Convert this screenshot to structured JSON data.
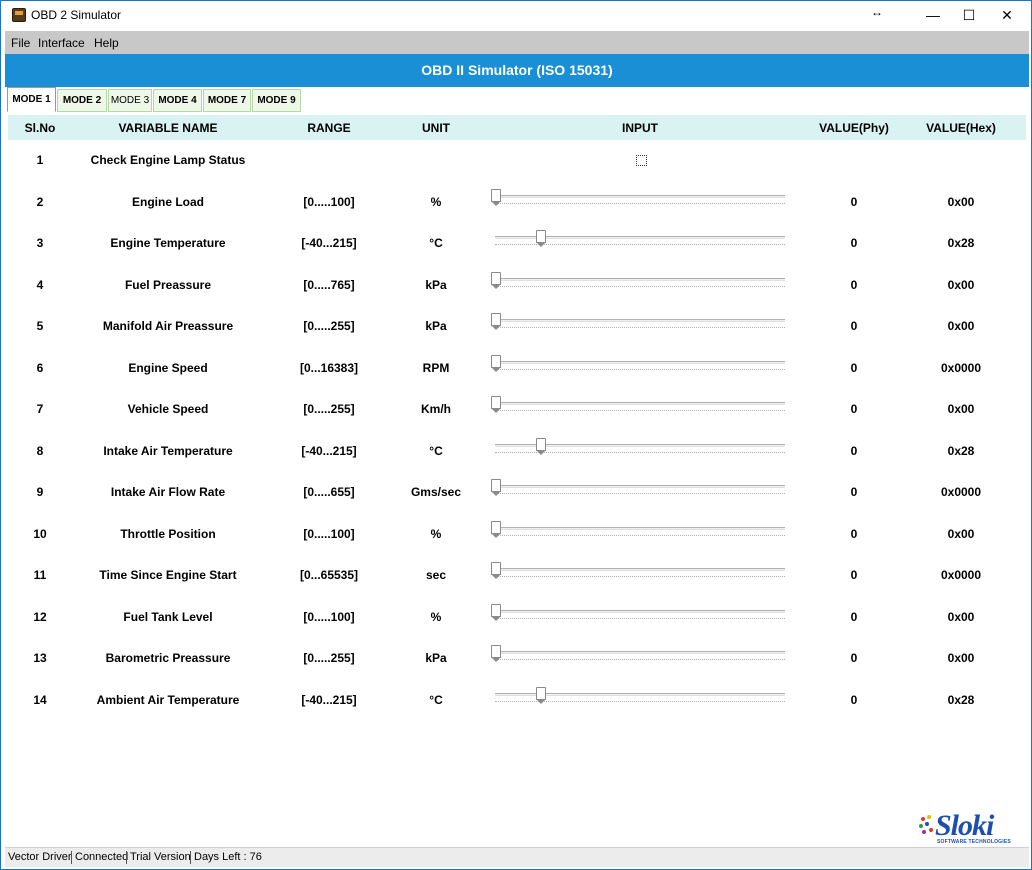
{
  "window": {
    "title": "OBD 2 Simulator",
    "resize_glyph": "↔",
    "minimize_glyph": "—",
    "maximize_glyph": "☐",
    "close_glyph": "✕"
  },
  "menu": [
    "File",
    "Interface",
    "Help"
  ],
  "header": {
    "title": "OBD II Simulator (ISO 15031)",
    "color": "#1a8fd6"
  },
  "tabs": [
    {
      "label": "MODE 1",
      "active": true
    },
    {
      "label": "MODE 2"
    },
    {
      "label": "MODE 3"
    },
    {
      "label": "MODE 4"
    },
    {
      "label": "MODE 7"
    },
    {
      "label": "MODE 9"
    }
  ],
  "columns": {
    "sl_no": "Sl.No",
    "variable_name": "VARIABLE NAME",
    "range": "RANGE",
    "unit": "UNIT",
    "input": "INPUT",
    "value_phy": "VALUE(Phy)",
    "value_hex": "VALUE(Hex)"
  },
  "rows": [
    {
      "sl": "1",
      "name": "Check Engine Lamp Status",
      "range": "",
      "unit": "",
      "input": "checkbox",
      "checked": false,
      "phy": "",
      "hex": ""
    },
    {
      "sl": "2",
      "name": "Engine Load",
      "range": "[0.....100]",
      "unit": "%",
      "input": "slider",
      "level": 0.0,
      "phy": "0",
      "hex": "0x00"
    },
    {
      "sl": "3",
      "name": "Engine Temperature",
      "range": "[-40...215]",
      "unit": "°C",
      "input": "slider",
      "level": 0.157,
      "phy": "0",
      "hex": "0x28"
    },
    {
      "sl": "4",
      "name": "Fuel Preassure",
      "range": "[0.....765]",
      "unit": "kPa",
      "input": "slider",
      "level": 0.0,
      "phy": "0",
      "hex": "0x00"
    },
    {
      "sl": "5",
      "name": "Manifold Air Preassure",
      "range": "[0.....255]",
      "unit": "kPa",
      "input": "slider",
      "level": 0.0,
      "phy": "0",
      "hex": "0x00"
    },
    {
      "sl": "6",
      "name": "Engine Speed",
      "range": "[0...16383]",
      "unit": "RPM",
      "input": "slider",
      "level": 0.0,
      "phy": "0",
      "hex": "0x0000"
    },
    {
      "sl": "7",
      "name": "Vehicle Speed",
      "range": "[0.....255]",
      "unit": "Km/h",
      "input": "slider",
      "level": 0.0,
      "phy": "0",
      "hex": "0x00"
    },
    {
      "sl": "8",
      "name": "Intake Air Temperature",
      "range": "[-40...215]",
      "unit": "°C",
      "input": "slider",
      "level": 0.157,
      "phy": "0",
      "hex": "0x28"
    },
    {
      "sl": "9",
      "name": "Intake Air Flow Rate",
      "range": "[0.....655]",
      "unit": "Gms/sec",
      "input": "slider",
      "level": 0.0,
      "phy": "0",
      "hex": "0x0000"
    },
    {
      "sl": "10",
      "name": "Throttle Position",
      "range": "[0.....100]",
      "unit": "%",
      "input": "slider",
      "level": 0.0,
      "phy": "0",
      "hex": "0x00"
    },
    {
      "sl": "11",
      "name": "Time Since Engine Start",
      "range": "[0...65535]",
      "unit": "sec",
      "input": "slider",
      "level": 0.0,
      "phy": "0",
      "hex": "0x0000"
    },
    {
      "sl": "12",
      "name": "Fuel Tank Level",
      "range": "[0.....100]",
      "unit": "%",
      "input": "slider",
      "level": 0.0,
      "phy": "0",
      "hex": "0x00"
    },
    {
      "sl": "13",
      "name": "Barometric Preassure",
      "range": "[0.....255]",
      "unit": "kPa",
      "input": "slider",
      "level": 0.0,
      "phy": "0",
      "hex": "0x00"
    },
    {
      "sl": "14",
      "name": "Ambient Air Temperature",
      "range": "[-40...215]",
      "unit": "°C",
      "input": "slider",
      "level": 0.157,
      "phy": "0",
      "hex": "0x28"
    }
  ],
  "logo": {
    "text": "Sloki",
    "tagline": "SOFTWARE TECHNOLOGIES",
    "color": "#1c4fb0"
  },
  "status": [
    "Vector Driver",
    "Connected",
    "Trial Version",
    "Days Left : 76"
  ]
}
